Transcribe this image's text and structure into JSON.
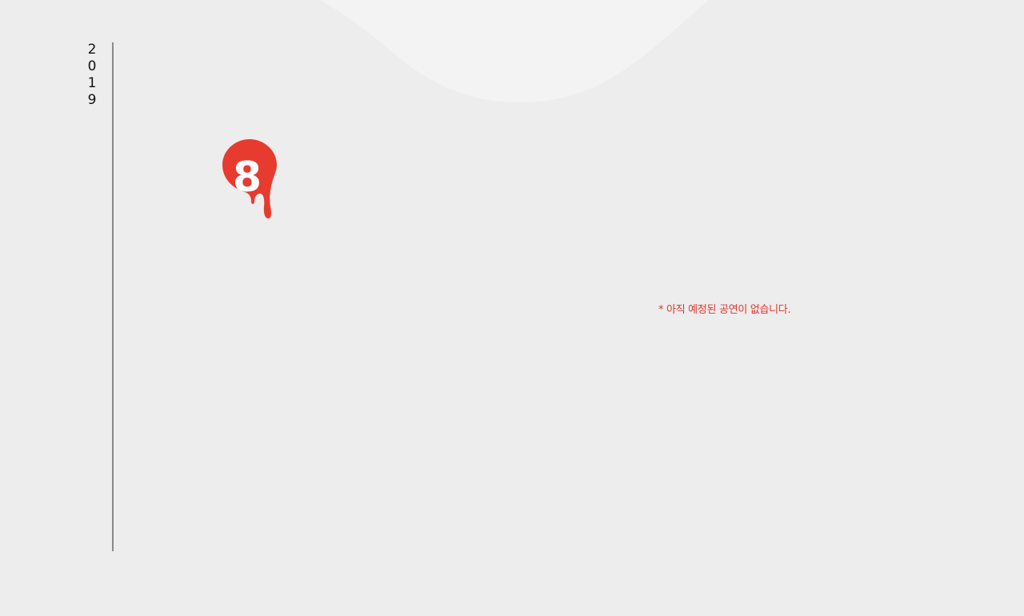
{
  "timeline": {
    "year_digits": [
      "2",
      "0",
      "1",
      "9"
    ]
  },
  "month_badge": {
    "month": "8",
    "color": "#e63b2e"
  },
  "schedule": {
    "empty_notice": "* 아직 예정된 공연이 없습니다."
  },
  "colors": {
    "background": "#ededed",
    "wave": "#f3f3f3",
    "accent": "#e0352b",
    "timeline_line": "#8a8a8a"
  }
}
